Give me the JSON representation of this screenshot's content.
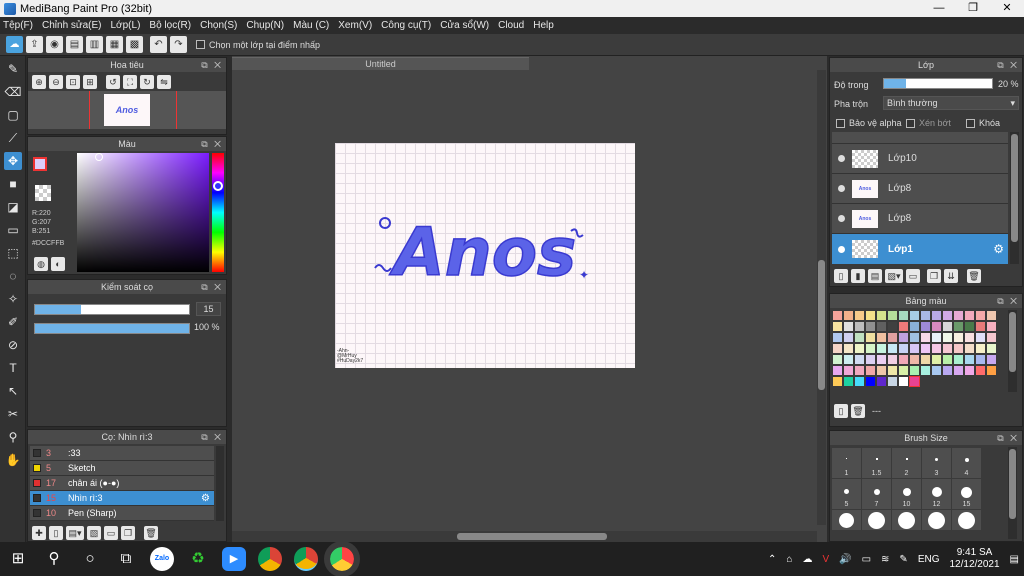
{
  "window": {
    "title": "MediBang Paint Pro (32bit)",
    "min": "—",
    "max": "❐",
    "close": "✕"
  },
  "menu": [
    "Tệp(F)",
    "Chỉnh sửa(E)",
    "Lớp(L)",
    "Bộ lọc(R)",
    "Chọn(S)",
    "Chụp(N)",
    "Màu (C)",
    "Xem(V)",
    "Công cụ(T)",
    "Cửa sổ(W)",
    "Cloud",
    "Help"
  ],
  "toolbar": {
    "checkbox_label": "Chọn một lớp tại điểm nhấp"
  },
  "navigator": {
    "title": "Hoa tiêu"
  },
  "color": {
    "title": "Màu",
    "r": "R:220",
    "g": "G:207",
    "b": "B:251",
    "hex": "#DCCFFB",
    "fg": "#dccffb"
  },
  "brush_control": {
    "title": "Kiểm soát cọ",
    "size": "15",
    "opacity": "100 %"
  },
  "brush_list": {
    "title": "Cọ: Nhìn rì:3",
    "items": [
      {
        "size": "3",
        "name": ":33",
        "color": "#333333"
      },
      {
        "size": "5",
        "name": "Sketch",
        "color": "#f0d400"
      },
      {
        "size": "17",
        "name": "chân ái (●-●)",
        "color": "#e03030"
      },
      {
        "size": "15",
        "name": "Nhìn rì:3",
        "color": "#333333"
      },
      {
        "size": "10",
        "name": "Pen (Sharp)",
        "color": "#333333"
      }
    ]
  },
  "canvas": {
    "tab": "Untitled",
    "art_text": "Anos",
    "credit": "-Ahn-\n@MrHuy\n#HuDay2k7"
  },
  "layers": {
    "title": "Lớp",
    "opacity_label": "Độ trong",
    "opacity_value": "20 %",
    "blend_label": "Pha trộn",
    "blend_value": "Bình thường",
    "protect_alpha": "Bảo vệ alpha",
    "clip": "Xén bớt",
    "lock": "Khóa",
    "items": [
      "Lớp10",
      "Lớp8",
      "Lớp8",
      "Lớp1"
    ]
  },
  "palette": {
    "title": "Bảng màu",
    "footer": "---",
    "colors": [
      "#f4a39a",
      "#f2b08a",
      "#f6c98a",
      "#f4e08a",
      "#d5e38c",
      "#b6de9a",
      "#a6d9c0",
      "#a7cde6",
      "#a9b8e6",
      "#b8a9e6",
      "#d0a9e6",
      "#e6a9d4",
      "#f2a9bc",
      "#f4a9a9",
      "#f0c8b0",
      "#f7e3a0",
      "#e0e0e0",
      "#bdbdbd",
      "#909090",
      "#606060",
      "#404040",
      "#f07a7a",
      "#8ab0d8",
      "#9f8ad8",
      "#d88ac0",
      "#d8d8d8",
      "#6a9a6a",
      "#4a7a4a",
      "#e87a7a",
      "#f7b0c0",
      "#b0c8f0",
      "#d0d0f0",
      "#c0e0c0",
      "#f0e0a0",
      "#f0c0a0",
      "#e0a0a0",
      "#c0a0e0",
      "#a0c0e0",
      "#f8d8e8",
      "#e8f0f8",
      "#f0f8e8",
      "#f8f0e0",
      "#f8e0e0",
      "#e0e0f8",
      "#f5c7cf",
      "#f5d4c7",
      "#f5e6c7",
      "#eef5c7",
      "#d6f5c7",
      "#c7f5e0",
      "#c7e8f5",
      "#c7d2f5",
      "#d7c7f5",
      "#eec7f5",
      "#f5c7e6",
      "#f5c7d2",
      "#f5c7c7",
      "#f3ddc9",
      "#f6efc9",
      "#e8f5cb",
      "#d1f2d0",
      "#cdeef0",
      "#d0dcf2",
      "#dcd0f2",
      "#ecd0f2",
      "#f2d0e4",
      "#f0a8b8",
      "#f0b8a8",
      "#f0d8a8",
      "#e0f0a8",
      "#b8f0a8",
      "#a8f0d0",
      "#a8d8f0",
      "#a8b8f0",
      "#c8a8f0",
      "#e8a8f0",
      "#f0a8d8",
      "#f0a8c0",
      "#f0a8a8",
      "#f0c8a8",
      "#f0e8a8",
      "#d8f0a8",
      "#a8f0b0",
      "#a8f0e0",
      "#a8c8f0",
      "#b8a8f0",
      "#d8a8f0",
      "#f0a8e8",
      "#ff6b6b",
      "#ff9f43",
      "#feca57",
      "#1dd1a1",
      "#48dbfb",
      "#0000ff",
      "#5f27cd",
      "#c8d6e5",
      "#ffffff",
      "#e84393"
    ]
  },
  "brush_size": {
    "title": "Brush Size",
    "row1": [
      "1",
      "1.5",
      "2",
      "3",
      "4"
    ],
    "row2": [
      "5",
      "7",
      "10",
      "12",
      "15"
    ]
  },
  "taskbar": {
    "time": "9:41 SA",
    "date": "12/12/2021",
    "lang": "ENG"
  }
}
